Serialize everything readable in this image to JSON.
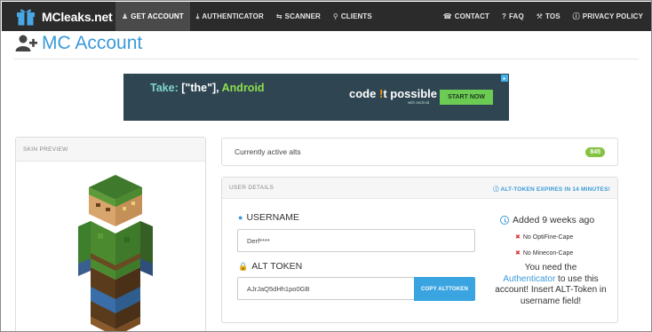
{
  "brand": {
    "name": "MCleaks.net"
  },
  "nav": {
    "items": [
      {
        "label": "GET ACCOUNT",
        "icon": "user-plus-icon",
        "active": true
      },
      {
        "label": "AUTHENTICATOR",
        "icon": "download-icon"
      },
      {
        "label": "SCANNER",
        "icon": "exchange-icon"
      },
      {
        "label": "CLIENTS",
        "icon": "sitemap-icon"
      }
    ],
    "right_items": [
      {
        "label": "CONTACT",
        "icon": "phone-icon"
      },
      {
        "label": "FAQ",
        "icon": "question-icon"
      },
      {
        "label": "TOS",
        "icon": "gavel-icon"
      },
      {
        "label": "PRIVACY POLICY",
        "icon": "info-circle-icon"
      }
    ]
  },
  "page": {
    "title": "MC Account",
    "title_icon": "user-plus-icon"
  },
  "ad": {
    "take": "Take:",
    "open": "[\"",
    "the": "the",
    "close": "\"],",
    "android": "Android",
    "code1": "code ",
    "bang": "!",
    "code2": "t possible",
    "with_android": "with android",
    "button": "START NOW"
  },
  "skin_panel": {
    "heading": "SKIN PREVIEW"
  },
  "alts": {
    "label": "Currently active alts",
    "count": "845"
  },
  "user_details": {
    "heading": "USER DETAILS",
    "expiry": "ALT-TOKEN EXPIRES IN 14 MINUTES!",
    "username_label": "USERNAME",
    "username_value": "Derf****",
    "token_label": "ALT TOKEN",
    "token_value": "AJrJaQ5dHh1po0GB",
    "copy_button": "COPY ALTTOKEN",
    "added": "Added 9 weeks ago",
    "no_optifine": "No OptiFine-Cape",
    "no_minecon": "No Minecon-Cape",
    "notice_pre": "You need the",
    "notice_link": "Authenticator",
    "notice_mid": " to use this account! Insert ALT-Token in username field!"
  },
  "colors": {
    "accent": "#3a9ad9",
    "navbar": "#2b2b2b",
    "badge": "#86c342",
    "error": "#d9312a"
  }
}
